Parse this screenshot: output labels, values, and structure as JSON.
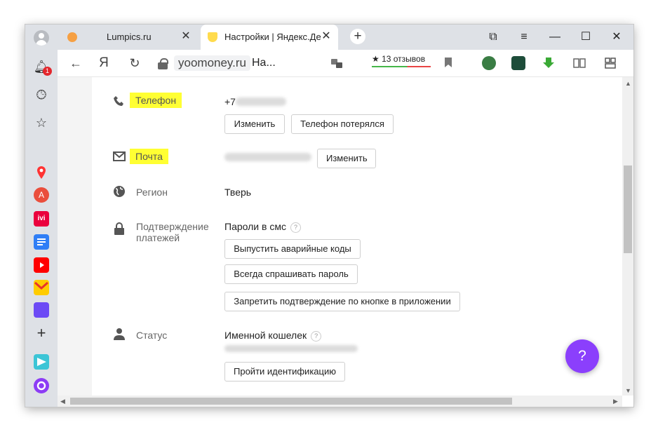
{
  "tabs": [
    {
      "title": "Lumpics.ru"
    },
    {
      "title": "Настройки | Яндекс.Де"
    }
  ],
  "window_controls": {
    "minimize": "—",
    "maximize": "☐",
    "close": "✕",
    "collections": "⧉",
    "menu": "≡"
  },
  "toolbar": {
    "back": "←",
    "yandex": "Я",
    "reload": "↻",
    "url_domain": "yoomoney.ru",
    "page_title": "На...",
    "reviews": "★ 13 отзывов",
    "download": "↓"
  },
  "sidebar": {
    "notification_count": "1"
  },
  "settings": {
    "phone": {
      "label": "Телефон",
      "value": "+7",
      "buttons": [
        "Изменить",
        "Телефон потерялся"
      ]
    },
    "email": {
      "label": "Почта",
      "button": "Изменить"
    },
    "region": {
      "label": "Регион",
      "value": "Тверь"
    },
    "payment_confirmation": {
      "label_line1": "Подтверждение",
      "label_line2": "платежей",
      "value": "Пароли в смс",
      "buttons": [
        "Выпустить аварийные коды",
        "Всегда спрашивать пароль",
        "Запретить подтверждение по кнопке в приложении"
      ]
    },
    "status": {
      "label": "Статус",
      "value": "Именной кошелек",
      "button": "Пройти идентификацию"
    }
  },
  "help_fab": "?",
  "help_hint": "?",
  "colors": {
    "highlight": "#ffff33",
    "fab": "#8b3ffc",
    "chrome": "#dee1e6"
  }
}
